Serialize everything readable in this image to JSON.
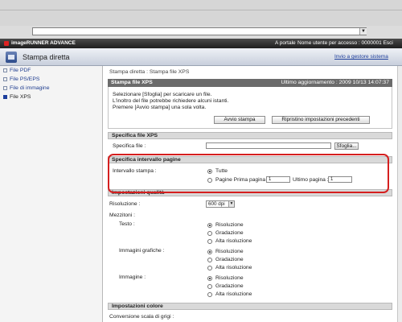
{
  "header": {
    "brand": "imageRUNNER ADVANCE",
    "portal_link": "A portale",
    "user_info": "Nome utente per accesso : 0000001 Esci",
    "app_title": "Stampa diretta",
    "send_link": "Invio a gestore sistema"
  },
  "sidebar": {
    "items": [
      {
        "label": "File PDF"
      },
      {
        "label": "File PS/EPS"
      },
      {
        "label": "File di immagine"
      },
      {
        "label": "File XPS"
      }
    ]
  },
  "breadcrumb": "Stampa diretta : Stampa file XPS",
  "panel": {
    "title": "Stampa file XPS",
    "updated": "Ultimo aggiornamento : 2009 10/13 14:07:37",
    "instructions": [
      "Selezionare [Sfoglia] per scaricare un file.",
      "L'inoltro del file potrebbe richiedere alcuni istanti.",
      "Premere [Avvio stampa] una sola volta."
    ],
    "start_button": "Avvio stampa",
    "reset_button": "Ripristino impostazioni precedenti"
  },
  "file_spec": {
    "heading": "Specifica file XPS",
    "label": "Specifica file :",
    "browse": "Sfoglia..."
  },
  "range": {
    "heading": "Specifica intervallo pagine",
    "label": "Intervallo stampa :",
    "all": "Tutte",
    "pages": "Pagine Prima pagina :",
    "first_value": "1",
    "last_label": "Ultimo pagina :",
    "last_value": "1"
  },
  "quality": {
    "heading": "Impostazioni qualità",
    "resolution_label": "Risoluzione :",
    "resolution_value": "600 dpi",
    "halftone_label": "Mezzitoni :",
    "groups": [
      {
        "label": "Testo :",
        "options": [
          "Risoluzione",
          "Gradazione",
          "Alta risoluzione"
        ]
      },
      {
        "label": "Immagini grafiche :",
        "options": [
          "Risoluzione",
          "Gradazione",
          "Alta risoluzione"
        ]
      },
      {
        "label": "Immagine :",
        "options": [
          "Risoluzione",
          "Gradazione",
          "Alta risoluzione"
        ]
      }
    ]
  },
  "color": {
    "heading": "Impostazioni colore",
    "grayscale_label": "Conversione scala di grigi :"
  },
  "colors": {
    "highlight": "#d51f1f",
    "link": "#1e3f9c"
  }
}
